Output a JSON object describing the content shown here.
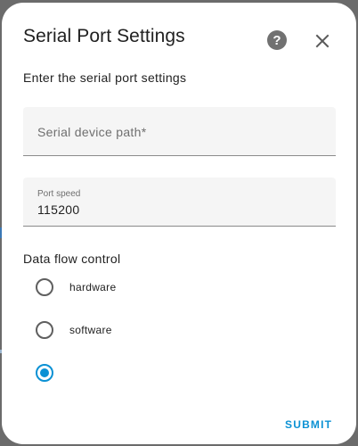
{
  "dialog": {
    "title": "Serial Port Settings",
    "subtitle": "Enter the serial port settings",
    "help_icon": "help-circle-icon",
    "close_icon": "close-icon"
  },
  "fields": {
    "device_path": {
      "placeholder": "Serial device path*",
      "value": ""
    },
    "port_speed": {
      "label": "Port speed",
      "value": "115200"
    }
  },
  "flow_control": {
    "label": "Data flow control",
    "options": [
      {
        "label": "hardware",
        "checked": false
      },
      {
        "label": "software",
        "checked": false
      },
      {
        "label": "",
        "checked": true
      }
    ]
  },
  "actions": {
    "submit_label": "SUBMIT"
  },
  "colors": {
    "accent": "#0b91d4",
    "field_bg": "#f5f5f5",
    "text": "#212121"
  }
}
